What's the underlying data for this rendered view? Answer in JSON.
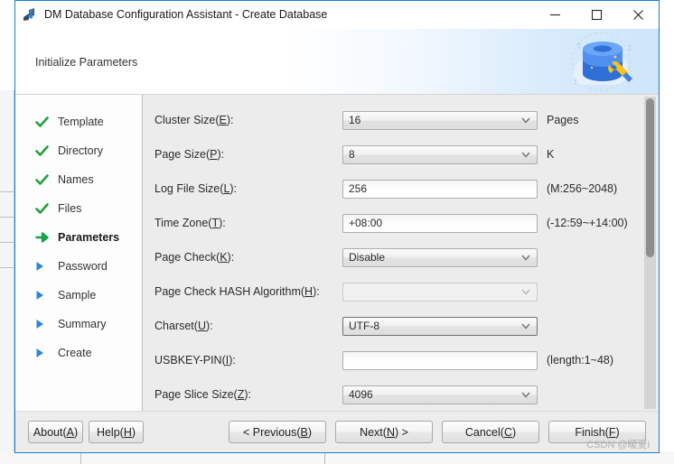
{
  "window": {
    "title": "DM Database Configuration Assistant - Create Database",
    "app_icon": "dm-database-app-icon",
    "minimize_label": "—",
    "maximize_label": "□",
    "close_label": "✕"
  },
  "banner": {
    "title": "Initialize Parameters",
    "art": "database-wrench-illustration"
  },
  "sidebar": {
    "items": [
      {
        "label": "Template",
        "state": "done",
        "icon": "check-icon"
      },
      {
        "label": "Directory",
        "state": "done",
        "icon": "check-icon"
      },
      {
        "label": "Names",
        "state": "done",
        "icon": "check-icon"
      },
      {
        "label": "Files",
        "state": "done",
        "icon": "check-icon"
      },
      {
        "label": "Parameters",
        "state": "current",
        "icon": "arrow-right-icon"
      },
      {
        "label": "Password",
        "state": "pending",
        "icon": "triangle-right-icon"
      },
      {
        "label": "Sample",
        "state": "pending",
        "icon": "triangle-right-icon"
      },
      {
        "label": "Summary",
        "state": "pending",
        "icon": "triangle-right-icon"
      },
      {
        "label": "Create",
        "state": "pending",
        "icon": "triangle-right-icon"
      }
    ]
  },
  "form": {
    "rows": [
      {
        "name": "cluster-size",
        "label_pre": "Cluster Size(",
        "mnemonic": "E",
        "label_post": "):",
        "control": "combo",
        "value": "16",
        "suffix": "Pages",
        "state": "enabled"
      },
      {
        "name": "page-size",
        "label_pre": "Page Size(",
        "mnemonic": "P",
        "label_post": "):",
        "control": "combo",
        "value": "8",
        "suffix": "K",
        "state": "enabled"
      },
      {
        "name": "log-file-size",
        "label_pre": "Log File Size(",
        "mnemonic": "L",
        "label_post": "):",
        "control": "text",
        "value": "256",
        "suffix": "(M:256~2048)",
        "state": "enabled"
      },
      {
        "name": "time-zone",
        "label_pre": "Time Zone(",
        "mnemonic": "T",
        "label_post": "):",
        "control": "text",
        "value": "+08:00",
        "suffix": "(-12:59~+14:00)",
        "state": "enabled"
      },
      {
        "name": "page-check",
        "label_pre": "Page Check(",
        "mnemonic": "K",
        "label_post": "):",
        "control": "combo",
        "value": "Disable",
        "suffix": "",
        "state": "enabled"
      },
      {
        "name": "page-check-hash-algorithm",
        "label_pre": "Page Check HASH Algorithm(",
        "mnemonic": "H",
        "label_post": "):",
        "control": "combo",
        "value": "",
        "suffix": "",
        "state": "disabled"
      },
      {
        "name": "charset",
        "label_pre": "Charset(",
        "mnemonic": "U",
        "label_post": "):",
        "control": "combo",
        "value": "UTF-8",
        "suffix": "",
        "state": "focused"
      },
      {
        "name": "usbkey-pin",
        "label_pre": "USBKEY-PIN(",
        "mnemonic": "I",
        "label_post": "):",
        "control": "text",
        "value": "",
        "suffix": "(length:1~48)",
        "state": "enabled"
      },
      {
        "name": "page-slice-size",
        "label_pre": "Page Slice Size(",
        "mnemonic": "Z",
        "label_post": "):",
        "control": "combo",
        "value": "4096",
        "suffix": "",
        "state": "enabled"
      }
    ]
  },
  "buttons": {
    "left": [
      {
        "name": "about-button",
        "pre": "About(",
        "mnemonic": "A",
        "post": ")"
      },
      {
        "name": "help-button",
        "pre": "Help(",
        "mnemonic": "H",
        "post": ")"
      }
    ],
    "right": [
      {
        "name": "previous-button",
        "pre": "< Previous(",
        "mnemonic": "B",
        "post": ")"
      },
      {
        "name": "next-button",
        "pre": "Next(",
        "mnemonic": "N",
        "post": ") >"
      },
      {
        "name": "cancel-button",
        "pre": "Cancel(",
        "mnemonic": "C",
        "post": ")"
      },
      {
        "name": "finish-button",
        "pre": "Finish(",
        "mnemonic": "F",
        "post": ")"
      }
    ]
  },
  "watermark": {
    "text": "CSDN @暖夏i"
  },
  "colors": {
    "window_border": "#1d7fd0",
    "panel_bg": "#ececec",
    "sidebar_bg": "#fdfdfd",
    "done_mark": "#22a03c",
    "current_mark": "#16a34a",
    "pending_mark": "#2f86d6",
    "banner_accent": "#cfe5fa"
  }
}
